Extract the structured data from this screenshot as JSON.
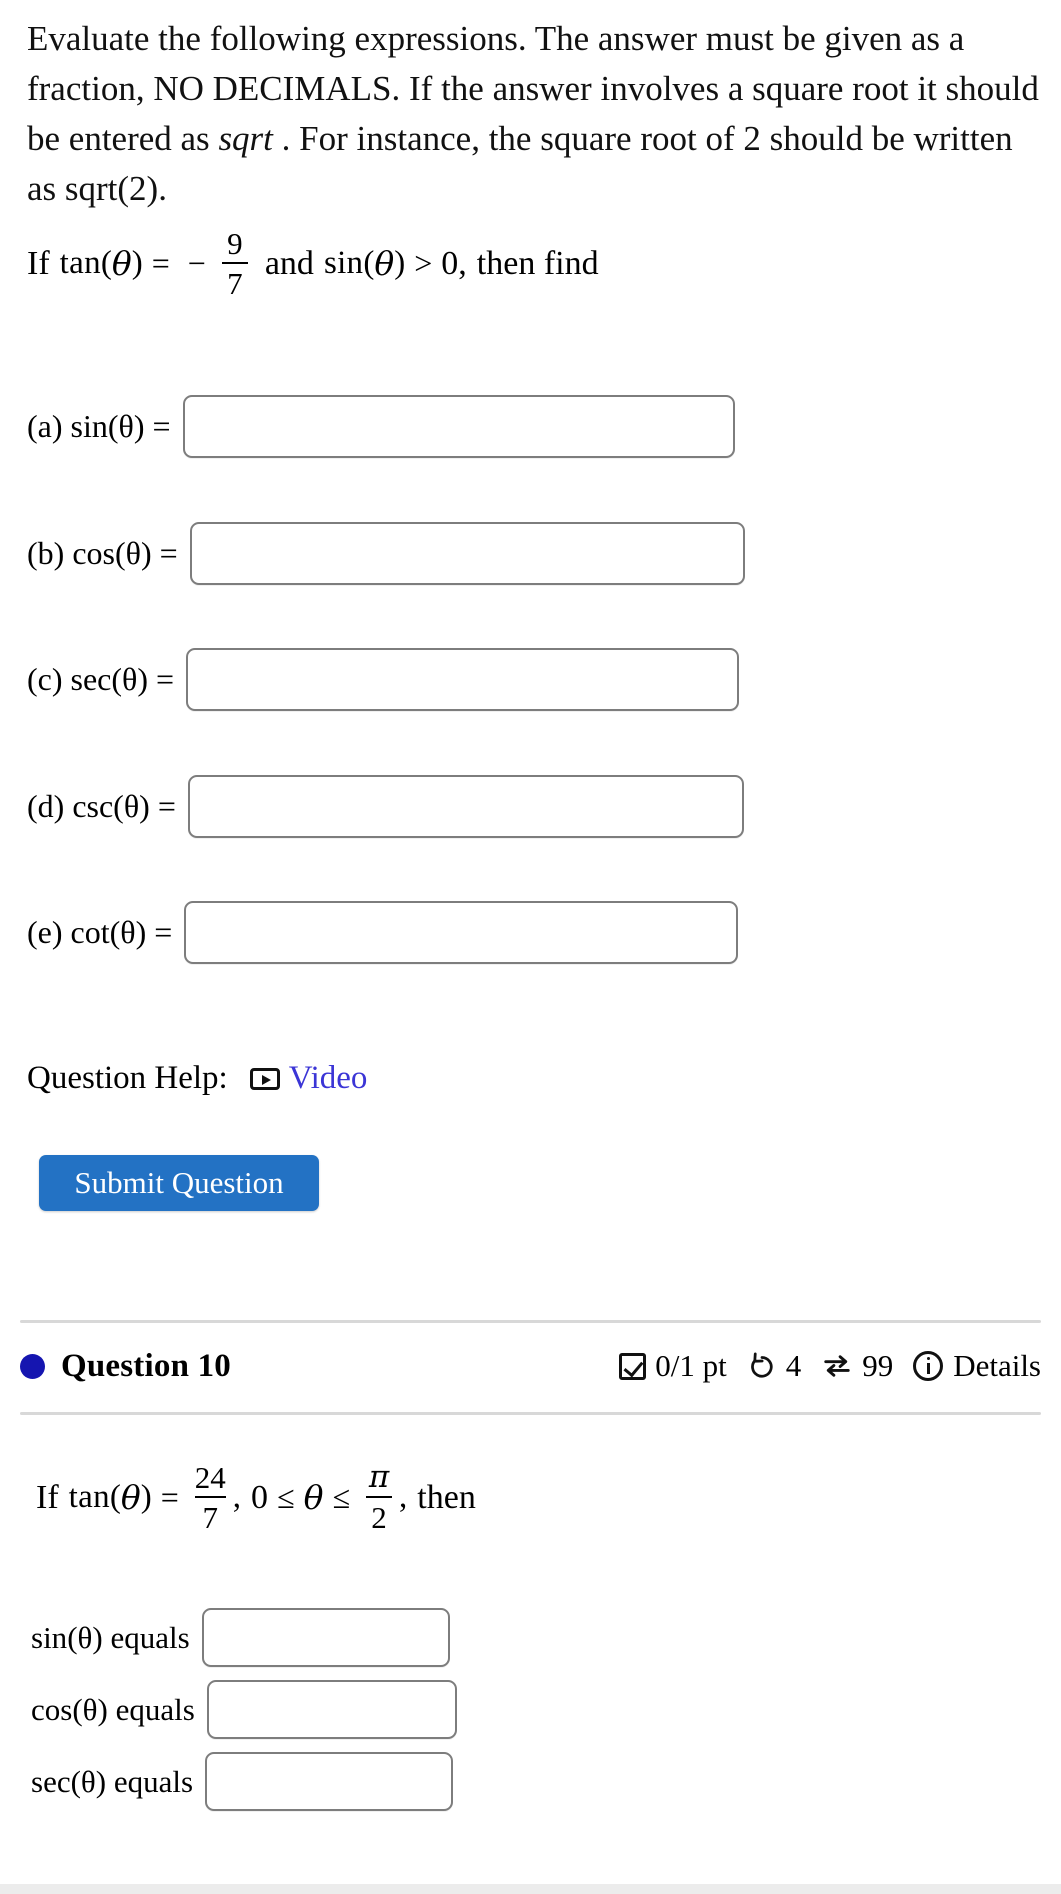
{
  "instructions": {
    "line1": "Evaluate the following expressions. The answer must be",
    "line2_a": "given as a fraction, NO DECIMALS. If the answer involves a",
    "line3_a": "square root it should be entered as ",
    "line3_italic": "sqrt",
    "line3_b": " . For instance, the",
    "line4": "square root of 2 should be written as sqrt(2)."
  },
  "question9": {
    "prompt": {
      "if_text": "If",
      "function": "tan",
      "theta": "θ",
      "equals": "=",
      "minus": "−",
      "numerator": "9",
      "denominator": "7",
      "and_text": "and",
      "function2": "sin",
      "gt": ">",
      "zero": "0,",
      "then_find": "then find"
    },
    "answers": [
      {
        "label": "(a) sin(θ) =",
        "prefix": "(a)",
        "fn": "sin",
        "theta": "θ",
        "eq": "=",
        "value": "",
        "placeholder": ""
      },
      {
        "label": "(b) cos(θ) =",
        "prefix": "(b)",
        "fn": "cos",
        "theta": "θ",
        "eq": "=",
        "value": "",
        "placeholder": ""
      },
      {
        "label": "(c) sec(θ) =",
        "prefix": "(c)",
        "fn": "sec",
        "theta": "θ",
        "eq": "=",
        "value": "",
        "placeholder": ""
      },
      {
        "label": "(d) csc(θ) =",
        "prefix": "(d)",
        "fn": "csc",
        "theta": "θ",
        "eq": "=",
        "value": "",
        "placeholder": ""
      },
      {
        "label": "(e) cot(θ) =",
        "prefix": "(e)",
        "fn": "cot",
        "theta": "θ",
        "eq": "=",
        "value": "",
        "placeholder": ""
      }
    ],
    "help": {
      "label": "Question Help:",
      "video_icon": "video-play-icon",
      "video_link": "Video"
    },
    "submit_label": "Submit Question"
  },
  "question10": {
    "bullet_color": "#1515b0",
    "title": "Question 10",
    "status": {
      "points_icon": "checkbox-check-icon",
      "points": "0/1 pt",
      "attempts_icon": "undo-arrow-icon",
      "attempts": "4",
      "versions_icon": "swap-arrows-icon",
      "versions": "99",
      "details_icon": "info-circle-icon",
      "details": "Details"
    },
    "prompt": {
      "if_text": "If",
      "function": "tan",
      "theta": "θ",
      "equals": "=",
      "numerator": "24",
      "denominator": "7",
      "comma": ",",
      "lower_bound": "0",
      "le1": "≤",
      "var": "θ",
      "le2": "≤",
      "pi": "π",
      "two": "2",
      "then_text": "then"
    },
    "answers": [
      {
        "fn": "sin",
        "theta": "θ",
        "equals_word": "equals",
        "value": "",
        "placeholder": ""
      },
      {
        "fn": "cos",
        "theta": "θ",
        "equals_word": "equals",
        "value": "",
        "placeholder": ""
      },
      {
        "fn": "sec",
        "theta": "θ",
        "equals_word": "equals",
        "value": "",
        "placeholder": ""
      }
    ]
  },
  "colors": {
    "link": "#3b35d6",
    "submit_button": "#2372c4",
    "bullet": "#1515b0",
    "divider": "#d8d8d8",
    "input_border": "#7d7d7d"
  }
}
